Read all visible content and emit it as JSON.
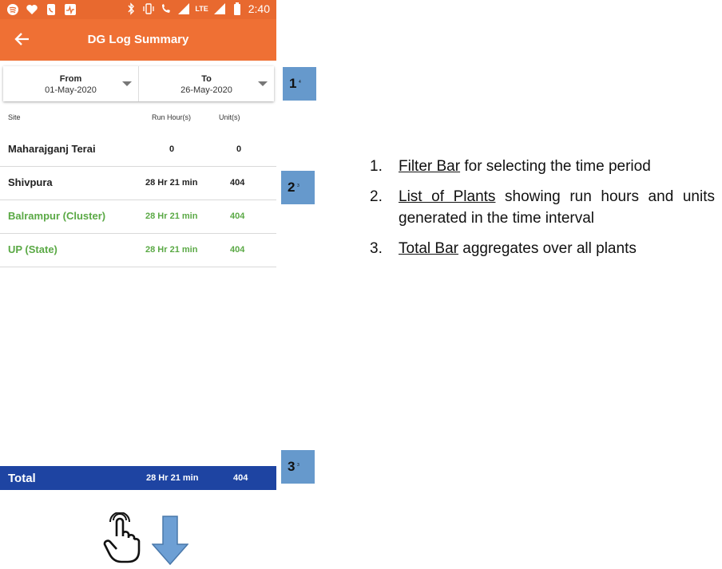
{
  "status_bar": {
    "time": "2:40",
    "left_icons": [
      "spotify-icon",
      "heart-icon",
      "phone-icon",
      "activity-icon"
    ],
    "right_icons": [
      "bluetooth-icon",
      "vibrate-icon",
      "volte-call-icon",
      "signal-icon",
      "lte-signal-icon",
      "battery-icon"
    ],
    "lte_label": "LTE"
  },
  "app_bar": {
    "title": "DG Log Summary",
    "back_icon": "arrow-left-icon"
  },
  "filter": {
    "from_label": "From",
    "from_value": "01-May-2020",
    "to_label": "To",
    "to_value": "26-May-2020"
  },
  "table": {
    "headers": {
      "site": "Site",
      "run": "Run Hour(s)",
      "unit": "Unit(s)"
    },
    "rows": [
      {
        "site": "Maharajganj Terai",
        "run": "0",
        "unit": "0",
        "color": "#222222"
      },
      {
        "site": "Shivpura",
        "run": "28 Hr 21 min",
        "unit": "404",
        "color": "#222222"
      },
      {
        "site": "Balrampur (Cluster)",
        "run": "28 Hr 21 min",
        "unit": "404",
        "color": "#5aa945"
      },
      {
        "site": "UP (State)",
        "run": "28 Hr 21 min",
        "unit": "404",
        "color": "#5aa945"
      }
    ]
  },
  "total": {
    "label": "Total",
    "run": "28 Hr 21 min",
    "unit": "404"
  },
  "markers": [
    {
      "num": "1",
      "sub": "4"
    },
    {
      "num": "2",
      "sub": "3"
    },
    {
      "num": "3",
      "sub": "3"
    }
  ],
  "notes": [
    {
      "num": "1.",
      "term": "Filter Bar",
      "rest": " for selecting the time period"
    },
    {
      "num": "2.",
      "term": "List of Plants",
      "rest": " showing run hours and units generated in the time interval"
    },
    {
      "num": "3.",
      "term": "Total Bar",
      "rest": " aggregates over all plants"
    }
  ],
  "colors": {
    "app_bar": "#ef7034",
    "status_bar": "#e8692f",
    "total_bar": "#1e44a2",
    "marker": "#6699cc",
    "green_text": "#5aa945"
  },
  "gestures": [
    "tap-hand-icon",
    "scroll-down-arrow-icon"
  ]
}
